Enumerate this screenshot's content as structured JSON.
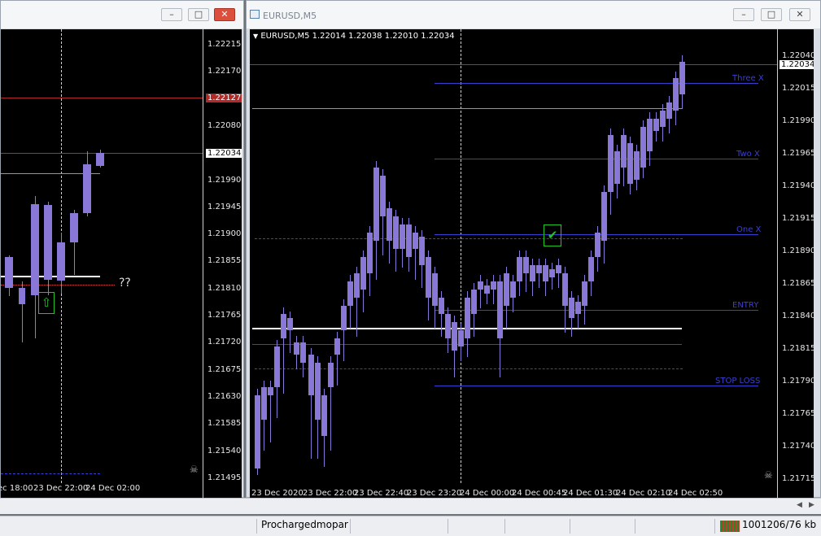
{
  "left_window": {
    "title": "",
    "controls": [
      "minimize",
      "maximize",
      "close"
    ],
    "price_scale": [
      "1.22215",
      "1.22170",
      "1.22125",
      "1.22080",
      "1.22035",
      "1.21990",
      "1.21945",
      "1.21900",
      "1.21855",
      "1.21810",
      "1.21765",
      "1.21720",
      "1.21675",
      "1.21630",
      "1.21585",
      "1.21540",
      "1.21495"
    ],
    "price_tag_red": "1.22127",
    "price_tag_current": "1.22034",
    "time_axis": [
      "ec 18:00",
      "23 Dec 22:00",
      "24 Dec 02:00"
    ],
    "annotation": "??"
  },
  "right_window": {
    "title": "EURUSD,M5",
    "header_text": "EURUSD,M5  1.22014 1.22038 1.22010 1.22034",
    "price_scale": [
      "1.22040",
      "1.22015",
      "1.21990",
      "1.21965",
      "1.21940",
      "1.21915",
      "1.21890",
      "1.21865",
      "1.21840",
      "1.21815",
      "1.21790",
      "1.21765",
      "1.21740",
      "1.21715"
    ],
    "current_price": "1.22034",
    "levels": [
      "Three X",
      "Two X",
      "One X",
      "ENTRY",
      "STOP LOSS"
    ],
    "time_axis": [
      "23 Dec 2020",
      "23 Dec 22:00",
      "23 Dec 22:40",
      "23 Dec 23:20",
      "24 Dec 00:00",
      "24 Dec 00:45",
      "24 Dec 01:30",
      "24 Dec 02:10",
      "24 Dec 02:50"
    ]
  },
  "status_bar": {
    "profile": "Prochargedmopar",
    "traffic": "1001206/76 kb"
  },
  "colors": {
    "candle": "#8a78d8",
    "level_line": "#3b3fd1",
    "entry_white": "#ffffff",
    "orange_line": "#d08a3e",
    "red_line": "#b02a2a",
    "signal_green": "#22c522"
  }
}
